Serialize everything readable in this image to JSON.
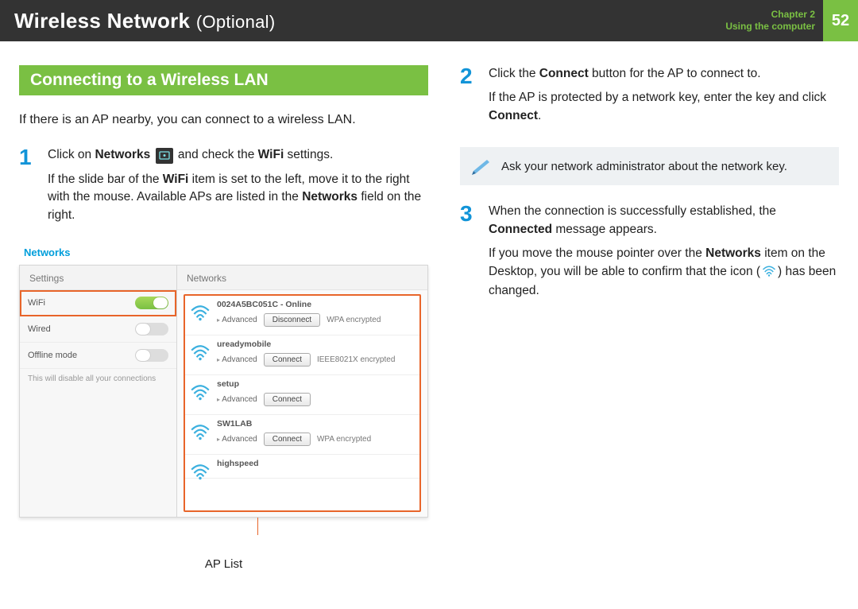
{
  "header": {
    "title_main": "Wireless Network",
    "title_suffix": "(Optional)",
    "chapter_line1": "Chapter 2",
    "chapter_line2": "Using the computer",
    "page_no": "52"
  },
  "section_heading": "Connecting to a Wireless LAN",
  "intro": "If there is an AP nearby, you can connect to a wireless LAN.",
  "steps": {
    "s1": {
      "num": "1",
      "p1a": "Click on ",
      "p1_bold1": "Networks",
      "p1b": " and check the ",
      "p1_bold2": "WiFi",
      "p1c": " settings.",
      "p2a": "If the slide bar of the ",
      "p2_bold": "WiFi",
      "p2b": " item is set to the left, move it to the right with the mouse. Available APs are listed in the ",
      "p2_bold2": "Networks",
      "p2c": " field on the right."
    },
    "s2": {
      "num": "2",
      "p1a": "Click the ",
      "p1_bold": "Connect",
      "p1b": " button for the AP to connect to.",
      "p2a": "If the AP is protected by a network key, enter the key and click ",
      "p2_bold": "Connect",
      "p2b": "."
    },
    "s3": {
      "num": "3",
      "p1a": "When the connection is successfully established, the ",
      "p1_bold": "Connected",
      "p1b": " message appears.",
      "p2a": "If you move the mouse pointer over the ",
      "p2_bold": "Networks",
      "p2b": " item on the Desktop, you will be able to confirm that the icon (",
      "p2c": ") has been changed."
    }
  },
  "callout_text": "Ask your network administrator about the network key.",
  "ap_caption": "AP List",
  "panel": {
    "title": "Networks",
    "sidebar_header": "Settings",
    "main_header": "Networks",
    "wifi_label": "WiFi",
    "wired_label": "Wired",
    "offline_label": "Offline mode",
    "offline_note": "This will disable all your connections",
    "ap_items": [
      {
        "name": "0024A5BC051C - Online",
        "advanced": "Advanced",
        "button": "Disconnect",
        "enc": "WPA encrypted"
      },
      {
        "name": "ureadymobile",
        "advanced": "Advanced",
        "button": "Connect",
        "enc": "IEEE8021X encrypted"
      },
      {
        "name": "setup",
        "advanced": "Advanced",
        "button": "Connect",
        "enc": ""
      },
      {
        "name": "SW1LAB",
        "advanced": "Advanced",
        "button": "Connect",
        "enc": "WPA encrypted"
      },
      {
        "name": "highspeed",
        "advanced": "",
        "button": "",
        "enc": ""
      }
    ]
  }
}
